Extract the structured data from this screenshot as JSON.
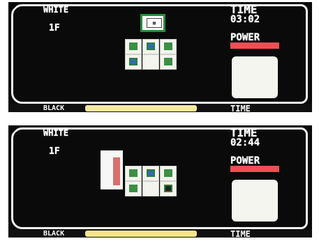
{
  "screens": [
    {
      "id": "top",
      "player_label": "WHITE",
      "floor": "1F",
      "time_label": "TIME",
      "time_value": "03:02",
      "power_label": "POWER",
      "colors": {
        "power_bar": "#ee4f52",
        "energy_bar": "#f5e9a0"
      },
      "bottom": {
        "opponent_label": "BLACK",
        "time_label": "TIME"
      }
    },
    {
      "id": "bottom",
      "player_label": "WHITE",
      "floor": "1F",
      "time_label": "TIME",
      "time_value": "02:44",
      "power_label": "POWER",
      "colors": {
        "power_bar": "#ee4f52",
        "energy_bar": "#f5e48a"
      },
      "bottom": {
        "opponent_label": "BLACK",
        "time_label": "TIME"
      }
    }
  ],
  "icons": {
    "safe": "safe-icon",
    "spy": "spy-character-icon"
  }
}
